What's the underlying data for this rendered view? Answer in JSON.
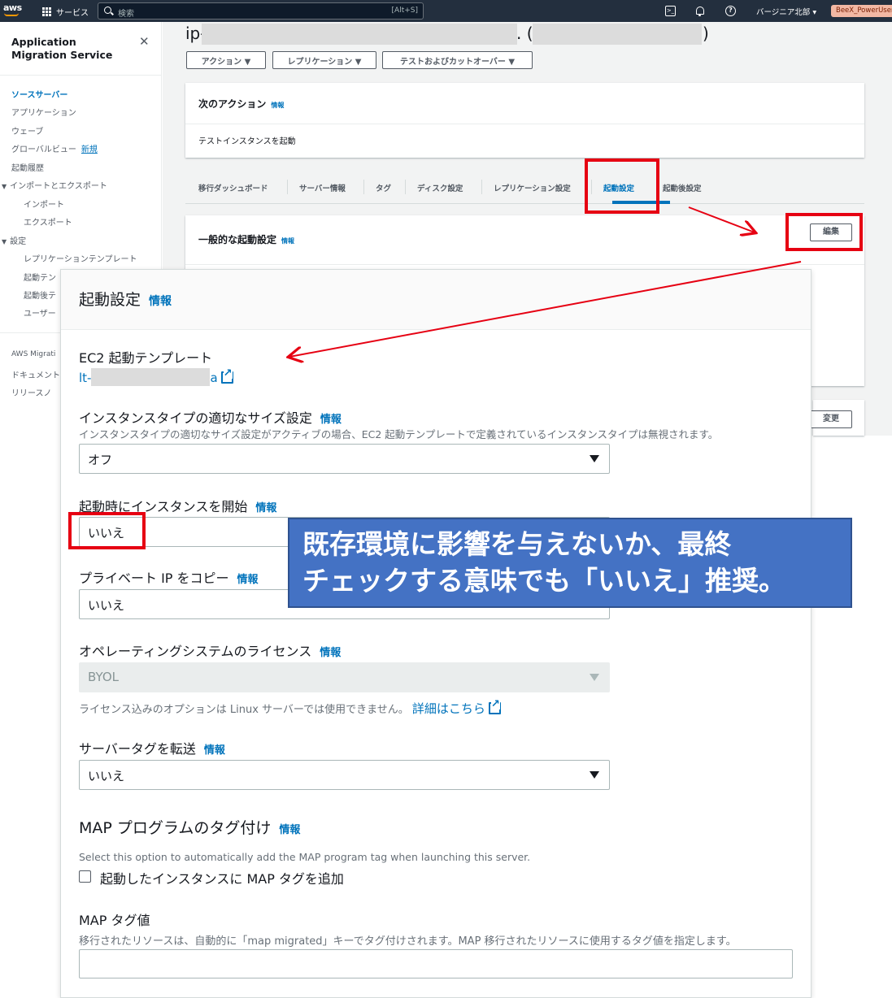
{
  "topnav": {
    "logo": "aws",
    "services": "サービス",
    "search_placeholder": "検索",
    "search_shortcut": "[Alt+S]",
    "cloudshell": ">_",
    "help": "?",
    "region": "バージニア北部 ▾",
    "account": "BeeX_PowerUser"
  },
  "sidebar": {
    "title": "Application Migration Service",
    "items": [
      {
        "label": "ソースサーバー",
        "active": true
      },
      {
        "label": "アプリケーション"
      },
      {
        "label": "ウェーブ"
      },
      {
        "label": "グローバルビュー",
        "badge": "新規"
      },
      {
        "label": "起動履歴"
      },
      {
        "label": "インポートとエクスポート"
      },
      {
        "label": "インポート"
      },
      {
        "label": "エクスポート"
      },
      {
        "label": "設定"
      },
      {
        "label": "レプリケーションテンプレート"
      },
      {
        "label": "起動テン"
      },
      {
        "label": "起動後テ"
      },
      {
        "label": "ユーザー"
      }
    ],
    "footer": [
      "AWS Migrati",
      "ドキュメント",
      "リリースノ"
    ]
  },
  "page": {
    "title_prefix": "ip-",
    "title_paren_open": ". (s",
    "title_paren_close": ")",
    "buttons": [
      "アクション ▼",
      "レプリケーション ▼",
      "テストおよびカットオーバー ▼"
    ]
  },
  "next_action": {
    "title": "次のアクション",
    "info": "情報",
    "text": "テストインスタンスを起動"
  },
  "tabs": [
    "移行ダッシュボード",
    "サーバー情報",
    "タグ",
    "ディスク設定",
    "レプリケーション設定",
    "起動設定",
    "起動後設定"
  ],
  "general_launch": {
    "title": "一般的な起動設定",
    "info": "情報",
    "edit_button": "編集",
    "change_button": "変更"
  },
  "panel": {
    "title": "起動設定",
    "info": "情報",
    "ec2_template_label": "EC2 起動テンプレート",
    "ec2_template_link_prefix": "lt-",
    "ec2_template_link_suffix": "a",
    "rightsizing_label": "インスタンスタイプの適切なサイズ設定",
    "rightsizing_desc": "インスタンスタイプの適切なサイズ設定がアクティブの場合、EC2 起動テンプレートで定義されているインスタンスタイプは無視されます。",
    "rightsizing_value": "オフ",
    "start_instance_label": "起動時にインスタンスを開始",
    "start_instance_value": "いいえ",
    "copy_private_ip_label": "プライベート IP をコピー",
    "copy_private_ip_value": "いいえ",
    "os_license_label": "オペレーティングシステムのライセンス",
    "os_license_value": "BYOL",
    "os_license_desc": "ライセンス込みのオプションは Linux サーバーでは使用できません。",
    "os_license_link": "詳細はこちら",
    "transfer_tags_label": "サーバータグを転送",
    "transfer_tags_value": "いいえ",
    "map_tagging_label": "MAP プログラムのタグ付け",
    "map_tagging_desc": "Select this option to automatically add the MAP program tag when launching this server.",
    "map_checkbox_label": "起動したインスタンスに MAP タグを追加",
    "map_tag_value_label": "MAP タグ値",
    "map_tag_value_desc": "移行されたリソースは、自動的に「map migrated」キーでタグ付けされます。MAP 移行されたリソースに使用するタグ値を指定します。",
    "map_tag_value": ""
  },
  "callout": {
    "line1": "既存環境に影響を与えないか、最終",
    "line2": "チェックする意味でも「いいえ」推奨。"
  },
  "colors": {
    "annotation_red": "#e60012",
    "callout_blue": "#4472c4",
    "link_blue": "#0073bb",
    "nav_dark": "#232f3e"
  }
}
